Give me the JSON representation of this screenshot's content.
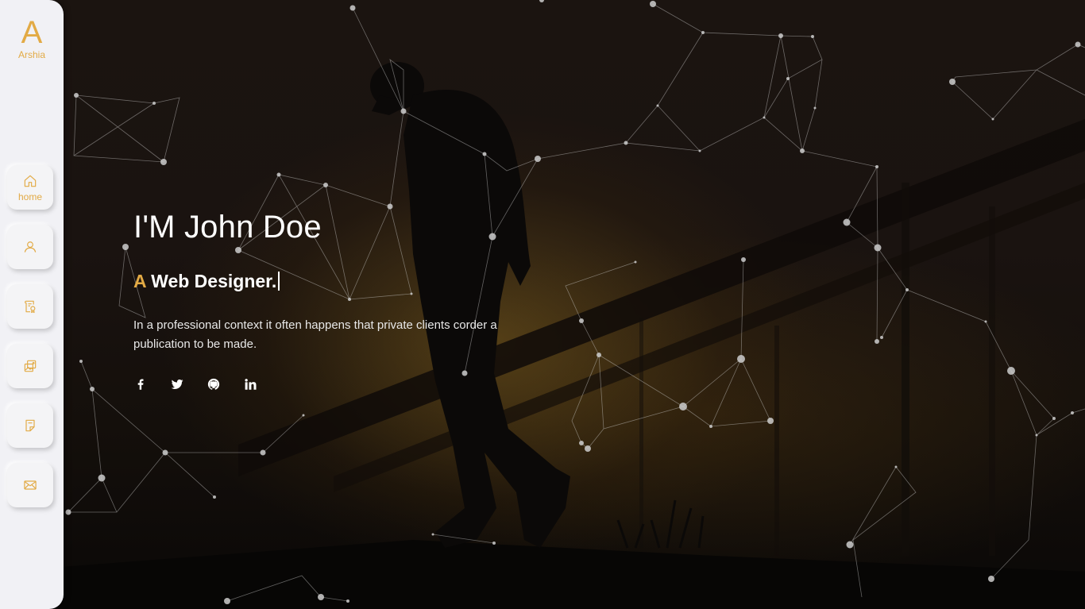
{
  "brand": {
    "letter": "A",
    "name": "Arshia",
    "accent_color": "#e2aa45"
  },
  "nav": [
    {
      "id": "home",
      "icon": "home-icon",
      "label": "home",
      "active": true
    },
    {
      "id": "about",
      "icon": "user-icon",
      "label": ""
    },
    {
      "id": "resume",
      "icon": "certificate-icon",
      "label": ""
    },
    {
      "id": "portfolio",
      "icon": "gallery-icon",
      "label": ""
    },
    {
      "id": "blog",
      "icon": "note-icon",
      "label": ""
    },
    {
      "id": "contact",
      "icon": "envelope-icon",
      "label": ""
    }
  ],
  "hero": {
    "title": "I'M John Doe",
    "role_prefix": "A",
    "role_text": "Web Designer.",
    "description": "In a professional context it often happens that private clients corder a publication to be made."
  },
  "socials": [
    {
      "id": "facebook",
      "icon": "facebook-icon"
    },
    {
      "id": "twitter",
      "icon": "twitter-icon"
    },
    {
      "id": "github",
      "icon": "github-icon"
    },
    {
      "id": "linkedin",
      "icon": "linkedin-icon"
    }
  ]
}
